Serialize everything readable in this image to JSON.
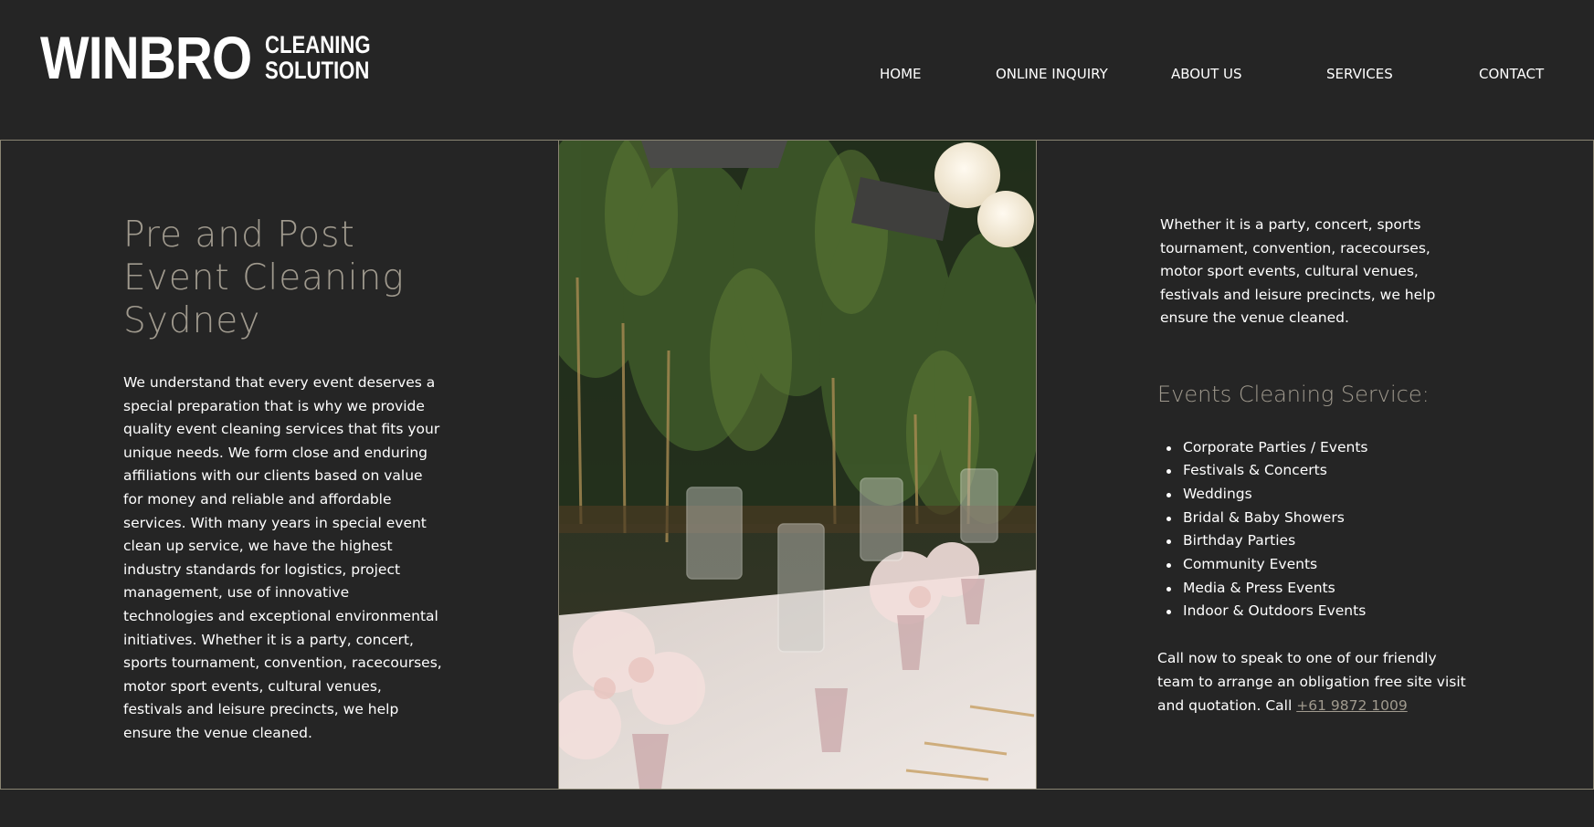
{
  "brand": {
    "name": "WINBRO",
    "tagline_line1": "CLEANING",
    "tagline_line2": "SOLUTION"
  },
  "nav": {
    "items": [
      {
        "label": "HOME"
      },
      {
        "label": "ONLINE INQUIRY"
      },
      {
        "label": "ABOUT US"
      },
      {
        "label": "SERVICES"
      },
      {
        "label": "CONTACT"
      }
    ]
  },
  "colors": {
    "background": "#252525",
    "accent_text": "#a09a8e",
    "border": "#8a8573"
  },
  "main": {
    "heading_line1": "Pre and Post",
    "heading_line2": "Event Cleaning",
    "heading_line3": "Sydney",
    "body": "We understand that every event deserves a special preparation that is why we provide quality event cleaning services that fits your unique needs. We form close and enduring affiliations with our clients based on value for money and reliable and affordable services. With many years in special event clean up service, we have the highest industry standards for logistics, project management, use of innovative technologies and exceptional environmental initiatives. Whether it is a party, concert, sports tournament, convention, racecourses, motor sport events, cultural venues, festivals and leisure precincts, we help ensure the venue cleaned.",
    "right_intro": "Whether it is a party, concert, sports tournament, convention, racecourses, motor sport events, cultural venues, festivals and leisure precincts, we help ensure the venue cleaned.",
    "services_title": "Events Cleaning Service:",
    "services": [
      "Corporate Parties / Events",
      "Festivals & Concerts",
      "Weddings",
      "Bridal & Baby Showers",
      "Birthday Parties",
      "Community Events",
      "Media & Press Events",
      "Indoor & Outdoors Events"
    ],
    "call_text": "Call now to speak to one of our friendly team to arrange an obligation free site visit and quotation. Call ",
    "phone": "+61 9872 1009"
  }
}
